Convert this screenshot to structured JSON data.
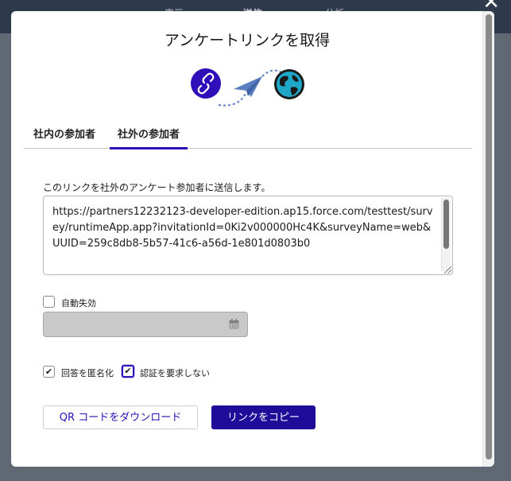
{
  "background_nav": {
    "items": [
      "表示",
      "送信",
      "分析"
    ],
    "close_glyph": "✕"
  },
  "modal": {
    "title": "アンケートリンクを取得",
    "hero_icons": [
      "link-icon",
      "paper-plane-icon",
      "globe-icon"
    ],
    "tabs": [
      {
        "label": "社内の参加者",
        "active": false
      },
      {
        "label": "社外の参加者",
        "active": true
      }
    ],
    "description": "このリンクを社外のアンケート参加者に送信します。",
    "url": "https://partners12232123-developer-edition.ap15.force.com/testtest/survey/runtimeApp.app?invitationId=0Ki2v000000Hc4K&surveyName=web&UUID=259c8db8-5b57-41c6-a56d-1e801d0803b0",
    "auto_expire": {
      "label": "自動失効",
      "checked": false,
      "date_value": "",
      "date_disabled": true
    },
    "anonymize": {
      "label": "回答を匿名化",
      "checked": true
    },
    "no_auth": {
      "label": "認証を要求しない",
      "checked": true
    },
    "buttons": {
      "download_qr": "QR コードをダウンロード",
      "copy_link": "リンクをコピー"
    }
  },
  "colors": {
    "brand": "#2e0fb8",
    "primary_button": "#1f0d99",
    "icon_blue": "#5a7fc0"
  }
}
